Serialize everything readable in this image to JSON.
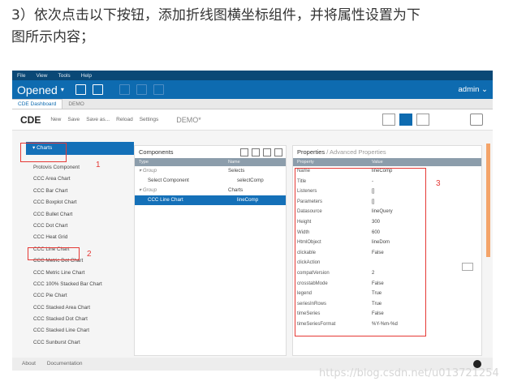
{
  "instruction": {
    "line1": "3）依次点击以下按钮，添加折线图横坐标组件，并将属性设置为下",
    "line2": "图所示内容；"
  },
  "menubar": [
    "File",
    "View",
    "Tools",
    "Help"
  ],
  "titlebar": {
    "opened": "Opened",
    "user": "admin"
  },
  "tabs": [
    "CDE Dashboard",
    "DEMO"
  ],
  "toolbar": {
    "logo": "CDE",
    "links": [
      "New",
      "Save",
      "Save as...",
      "Reload",
      "Settings"
    ],
    "dashboard_title": "DEMO*"
  },
  "left": {
    "category": "Charts",
    "items": [
      "Protovis Component",
      "CCC Area Chart",
      "CCC Bar Chart",
      "CCC Boxplot Chart",
      "CCC Bullet Chart",
      "CCC Dot Chart",
      "CCC Heat Grid",
      "CCC Line Chart",
      "CCC Metric Dot Chart",
      "CCC Metric Line Chart",
      "CCC 100% Stacked Bar Chart",
      "CCC Pie Chart",
      "CCC Stacked Area Chart",
      "CCC Stacked Dot Chart",
      "CCC Stacked Line Chart",
      "CCC Sunburst Chart"
    ]
  },
  "components": {
    "title": "Components",
    "col_type": "Type",
    "col_name": "Name",
    "rows": [
      {
        "type": "Group",
        "name": "Selects"
      },
      {
        "type": "Select Component",
        "name": "selectComp"
      },
      {
        "type": "Group",
        "name": "Charts"
      },
      {
        "type": "CCC Line Chart",
        "name": "lineComp"
      }
    ]
  },
  "properties": {
    "title": "Properties",
    "sep": "/",
    "advanced": "Advanced Properties",
    "col_property": "Property",
    "col_value": "Value",
    "rows": [
      {
        "name": "Name",
        "value": "lineComp"
      },
      {
        "name": "Title",
        "value": "-"
      },
      {
        "name": "Listeners",
        "value": "[]"
      },
      {
        "name": "Parameters",
        "value": "[]"
      },
      {
        "name": "Datasource",
        "value": "lineQuery"
      },
      {
        "name": "Height",
        "value": "300"
      },
      {
        "name": "Width",
        "value": "600"
      },
      {
        "name": "HtmlObject",
        "value": "lineDom"
      },
      {
        "name": "clickable",
        "value": "False"
      },
      {
        "name": "clickAction",
        "value": ""
      },
      {
        "name": "compatVersion",
        "value": "2"
      },
      {
        "name": "crosstabMode",
        "value": "False"
      },
      {
        "name": "legend",
        "value": "True"
      },
      {
        "name": "seriesInRows",
        "value": "True"
      },
      {
        "name": "timeSeries",
        "value": "False"
      },
      {
        "name": "timeSeriesFormat",
        "value": "%Y-%m-%d"
      }
    ]
  },
  "footer": [
    "About",
    "Documentation"
  ],
  "annotations": [
    "1",
    "2",
    "3"
  ],
  "watermark": "https://blog.csdn.net/u013721254",
  "colors": {
    "accent": "#0e6bb0",
    "annotation": "#e53935"
  }
}
